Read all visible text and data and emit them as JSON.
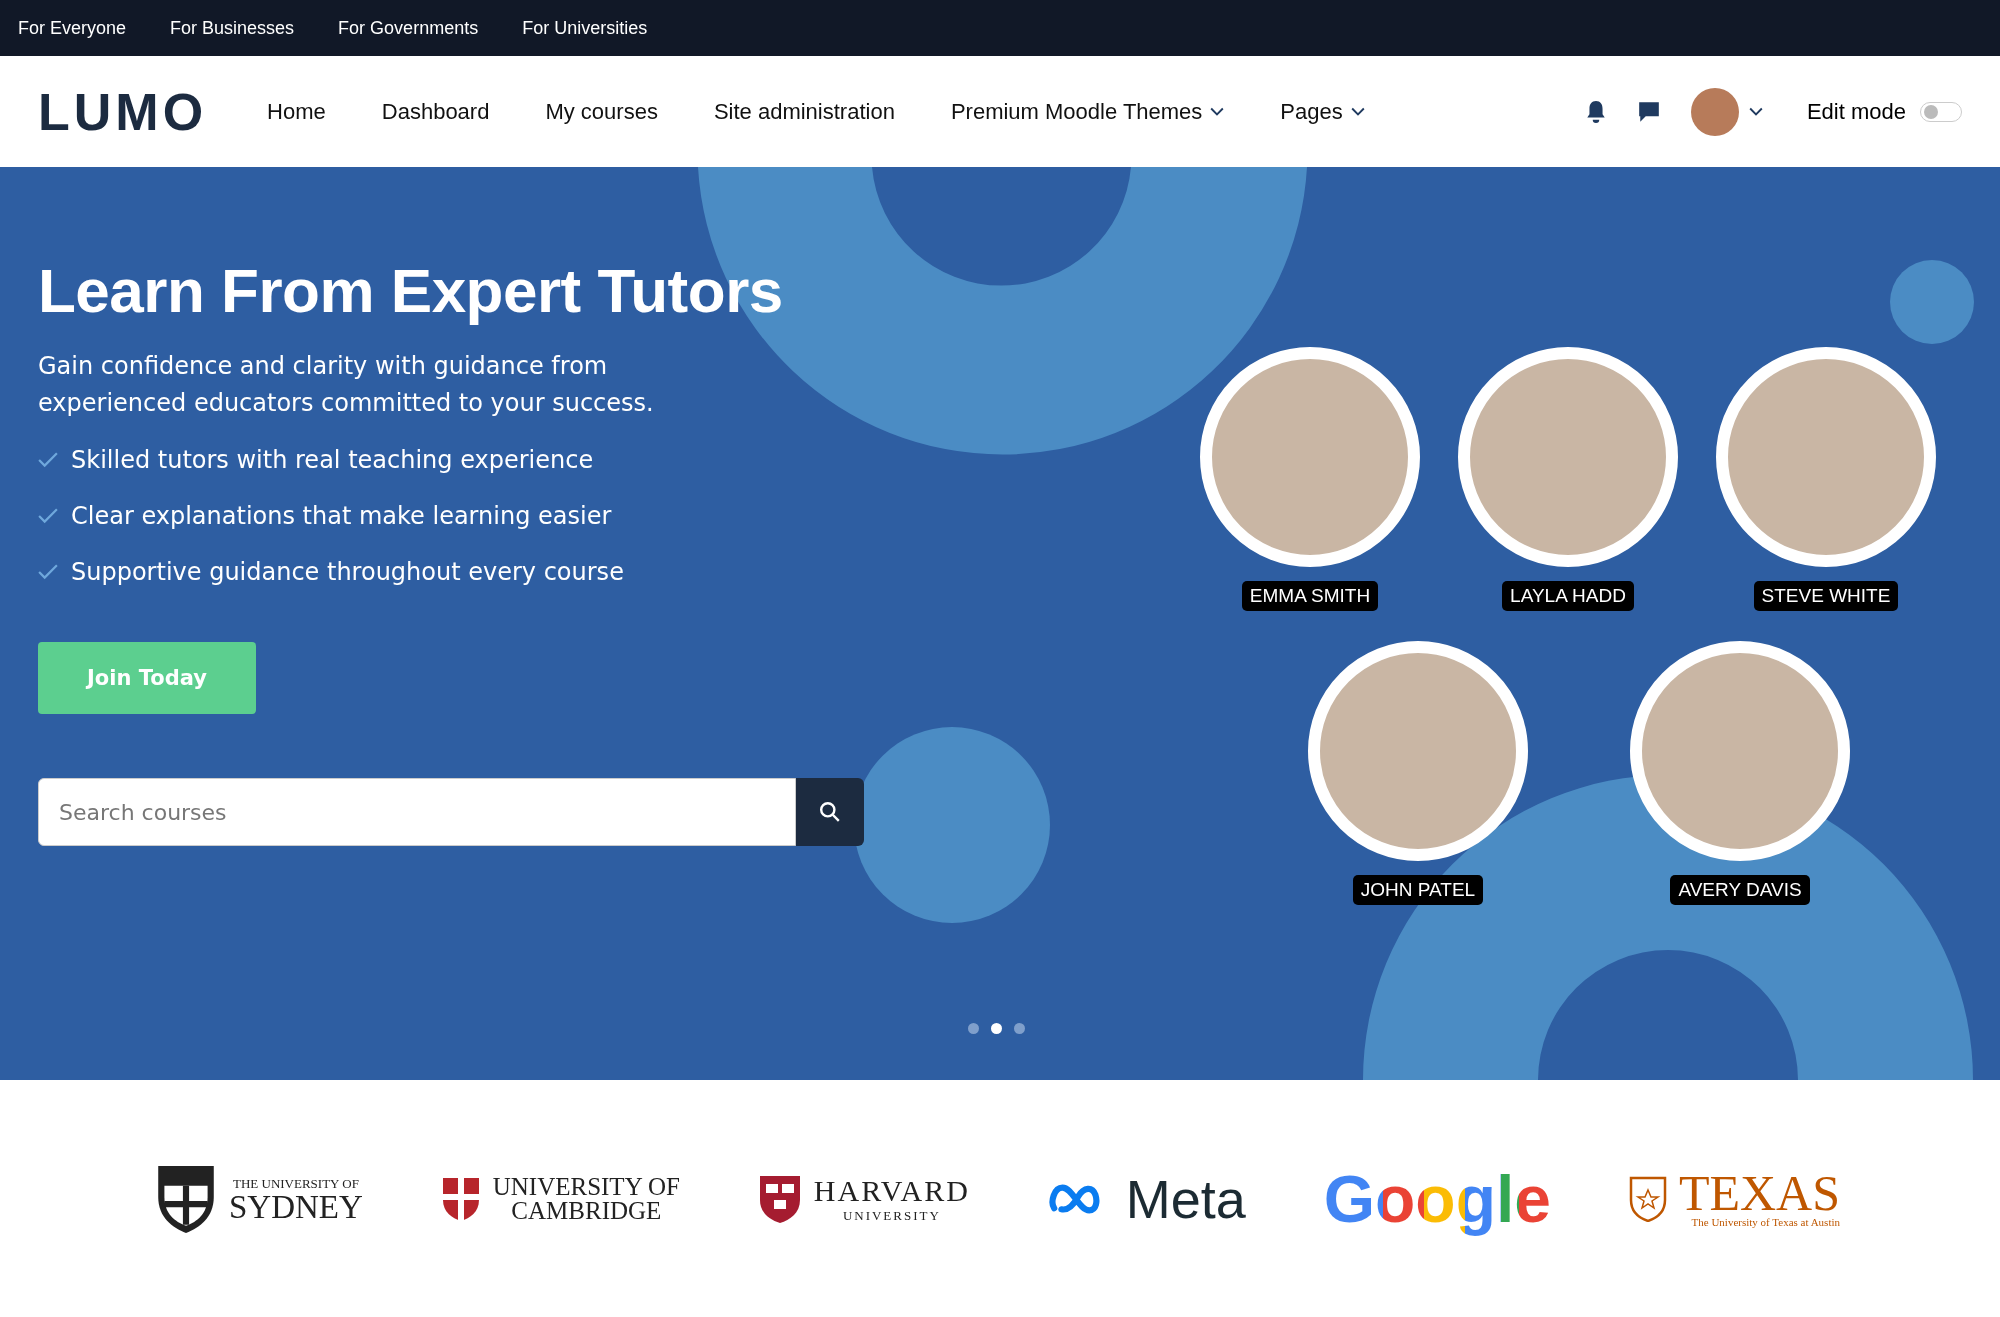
{
  "top_bar": {
    "links": [
      "For Everyone",
      "For Businesses",
      "For Governments",
      "For Universities"
    ]
  },
  "nav": {
    "logo": "LUMO",
    "items": [
      {
        "label": "Home",
        "dropdown": false
      },
      {
        "label": "Dashboard",
        "dropdown": false
      },
      {
        "label": "My courses",
        "dropdown": false
      },
      {
        "label": "Site administration",
        "dropdown": false
      },
      {
        "label": "Premium Moodle Themes",
        "dropdown": true
      },
      {
        "label": "Pages",
        "dropdown": true
      }
    ],
    "edit_mode": {
      "label": "Edit mode",
      "on": false
    }
  },
  "hero": {
    "title": "Learn From Expert Tutors",
    "subtitle": "Gain confidence and clarity with guidance from experienced educators committed to your success.",
    "features": [
      "Skilled tutors with real teaching experience",
      "Clear explanations that make learning easier",
      "Supportive guidance throughout every course"
    ],
    "button": "Join Today",
    "search": {
      "placeholder": "Search courses"
    },
    "dots": [
      {
        "selected": false
      },
      {
        "selected": true
      },
      {
        "selected": false
      }
    ],
    "tutors": [
      {
        "name": "EMMA SMITH"
      },
      {
        "name": "LAYLA HADD"
      },
      {
        "name": "STEVE WHITE"
      },
      {
        "name": "JOHN PATEL"
      },
      {
        "name": "AVERY DAVIS"
      }
    ]
  },
  "partners": [
    {
      "kind": "crest",
      "lines": [
        "THE UNIVERSITY OF",
        "SYDNEY"
      ]
    },
    {
      "kind": "shield",
      "lines": [
        "UNIVERSITY OF",
        "CAMBRIDGE"
      ]
    },
    {
      "kind": "harvard",
      "lines": [
        "HARVARD",
        "UNIVERSITY"
      ]
    },
    {
      "kind": "meta",
      "lines": [
        "Meta"
      ]
    },
    {
      "kind": "google",
      "lines": [
        "Google"
      ]
    },
    {
      "kind": "texas",
      "lines": [
        "TEXAS",
        "The University of Texas at Austin"
      ]
    }
  ]
}
